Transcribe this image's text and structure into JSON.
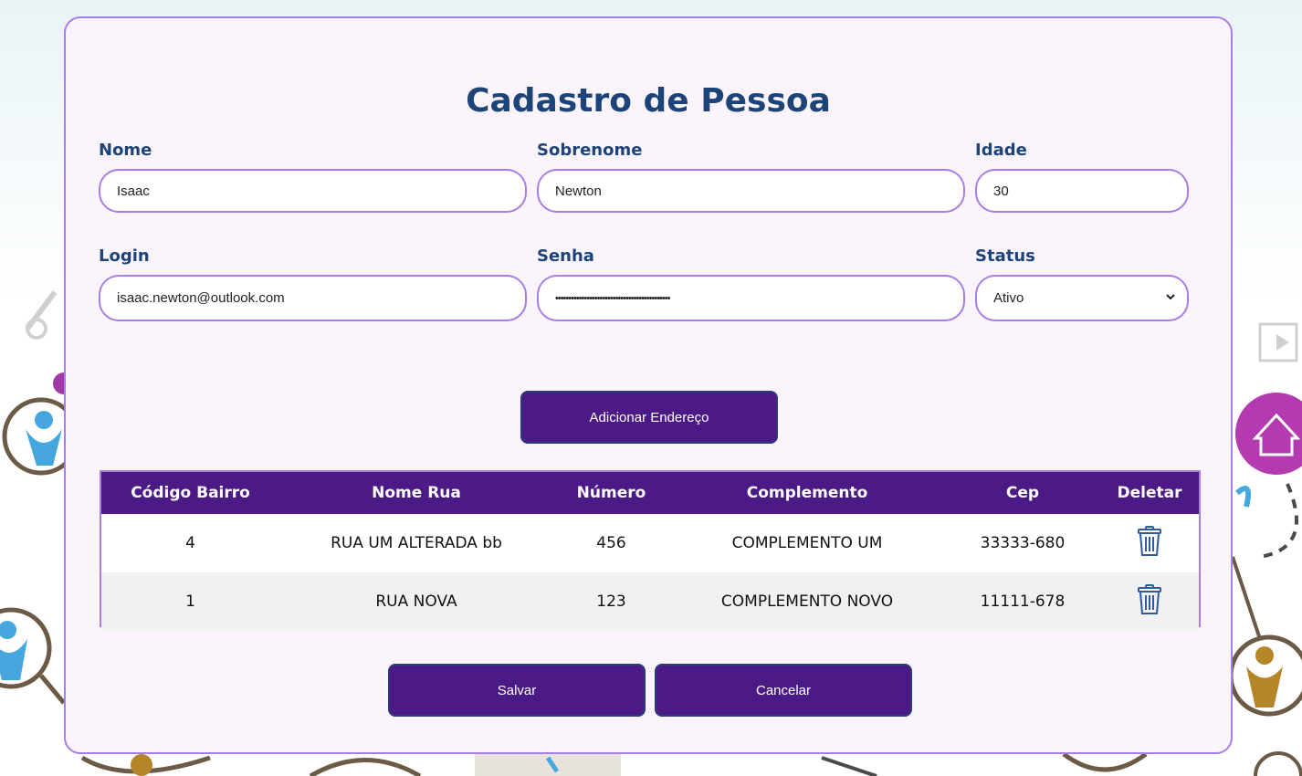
{
  "form": {
    "title": "Cadastro de Pessoa",
    "fields": {
      "nome": {
        "label": "Nome",
        "value": "Isaac"
      },
      "sobrenome": {
        "label": "Sobrenome",
        "value": "Newton"
      },
      "idade": {
        "label": "Idade",
        "value": "30"
      },
      "login": {
        "label": "Login",
        "value": "isaac.newton@outlook.com"
      },
      "senha": {
        "label": "Senha",
        "value": "••••••••••••••••••••••••••••••••••••••••••••"
      },
      "status": {
        "label": "Status",
        "value": "Ativo"
      }
    },
    "add_address_label": "Adicionar Endereço",
    "save_label": "Salvar",
    "cancel_label": "Cancelar"
  },
  "table": {
    "headers": [
      "Código Bairro",
      "Nome Rua",
      "Número",
      "Complemento",
      "Cep",
      "Deletar"
    ],
    "rows": [
      {
        "codigo_bairro": "4",
        "nome_rua": "RUA UM ALTERADA bb",
        "numero": "456",
        "complemento": "COMPLEMENTO UM",
        "cep": "33333-680"
      },
      {
        "codigo_bairro": "1",
        "nome_rua": "RUA NOVA",
        "numero": "123",
        "complemento": "COMPLEMENTO NOVO",
        "cep": "11111-678"
      }
    ]
  },
  "colors": {
    "accent_purple": "#4c1a86",
    "border_lavender": "#a87ee6",
    "title_blue": "#1c4478",
    "icon_blue": "#2d5aa0"
  },
  "icons": {
    "delete": "trash-icon",
    "select_arrow": "chevron-down-icon"
  }
}
